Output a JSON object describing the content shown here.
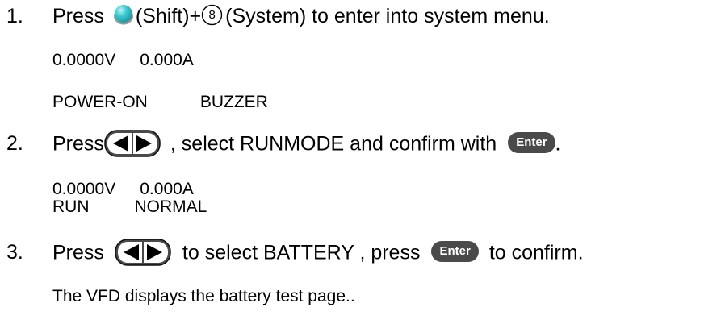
{
  "step1": {
    "number": "1.",
    "press": "Press",
    "shift_text": "(Shift)+",
    "system_key": "8",
    "system_text": "(System) to enter into system menu.",
    "display_line1_voltage": "0.0000V",
    "display_line1_current": "0.000A",
    "display_line2_left": "POWER-ON",
    "display_line2_right": "BUZZER"
  },
  "step2": {
    "number": "2.",
    "press": "Press",
    "middle_text": ", select RUNMODE and confirm with",
    "enter_label": "Enter",
    "end": ".",
    "display_line1_voltage": "0.0000V",
    "display_line1_current": "0.000A",
    "display_line2_left": "RUN",
    "display_line2_right": "NORMAL"
  },
  "step3": {
    "number": "3.",
    "press": "Press",
    "middle_text": "to select BATTERY , press",
    "enter_label": "Enter",
    "end_text": "to confirm.",
    "note": "The VFD displays the battery test page.."
  },
  "colors": {
    "shift_key": "#3cc7cf",
    "arrow_key": "#4a4a4a",
    "enter_key": "#4a4a4a",
    "text": "#000000"
  },
  "icons": {
    "shift": "shift-key-icon",
    "system": "number-8-key-icon",
    "arrows": "left-right-arrow-keys-icon",
    "enter": "enter-key-icon"
  }
}
